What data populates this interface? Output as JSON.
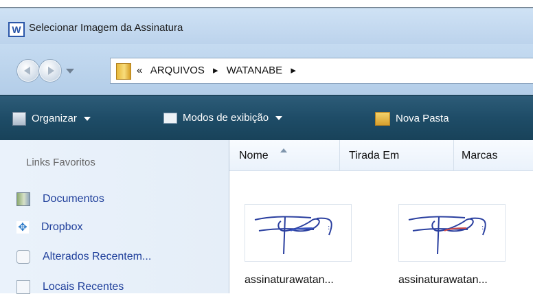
{
  "window": {
    "title": "Selecionar Imagem da Assinatura",
    "app_icon_letter": "W"
  },
  "address": {
    "overflow": "«",
    "breadcrumbs": [
      "ARQUIVOS",
      "▸",
      "WATANABE",
      "▸"
    ]
  },
  "toolbar": {
    "organize_label": "Organizar",
    "views_label": "Modos de exibição",
    "new_folder_label": "Nova Pasta"
  },
  "sidebar": {
    "title": "Links Favoritos",
    "items": [
      {
        "label": "Documentos",
        "icon": "documents-icon"
      },
      {
        "label": "Dropbox",
        "icon": "dropbox-icon"
      },
      {
        "label": "Alterados Recentem...",
        "icon": "recently-changed-icon"
      },
      {
        "label": "Locais Recentes",
        "icon": "recent-places-icon"
      }
    ]
  },
  "columns": [
    "Nome",
    "Tirada Em",
    "Marcas"
  ],
  "files": [
    {
      "name": "assinaturawatan..."
    },
    {
      "name": "assinaturawatan..."
    }
  ],
  "colors": {
    "titlebar": "#cfe2f5",
    "toolbar": "#1e4c67",
    "sidebar_link": "#1f3f9b"
  }
}
